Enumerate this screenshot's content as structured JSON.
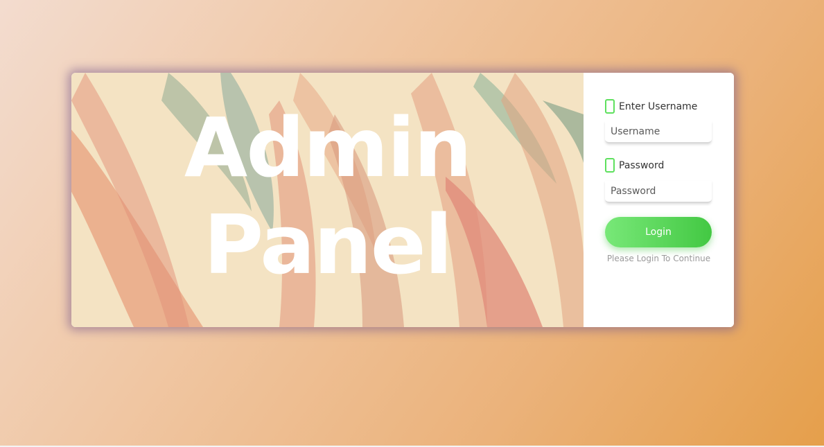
{
  "hero": {
    "title_line1": "Admin",
    "title_line2": "Panel"
  },
  "form": {
    "username_label": "Enter Username",
    "username_placeholder": "Username",
    "username_value": "",
    "password_label": "Password",
    "password_placeholder": "Password",
    "password_value": "",
    "login_label": "Login",
    "hint": "Please Login To Continue"
  },
  "colors": {
    "accent": "#5ee05e",
    "button_start": "#78e878",
    "button_end": "#43c843",
    "background_start": "#f3dccf",
    "background_end": "#e59f4b"
  }
}
